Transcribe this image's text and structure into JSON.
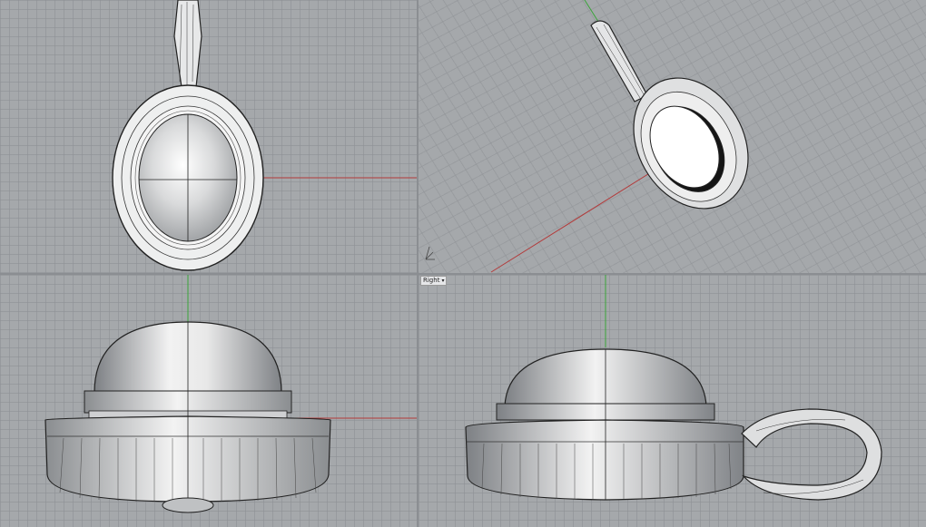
{
  "viewports": {
    "right": {
      "label": "Right"
    }
  },
  "colors": {
    "background": "#a5a8ab",
    "grid": "#8c8f93",
    "x_axis": "#b33a3a",
    "y_axis": "#3aa33a",
    "model_fill": "#d7d8da",
    "wire": "#1e1e1e"
  },
  "icons": {
    "tab_dropdown": "chevron-down-icon",
    "gumball": "axis-gizmo-icon"
  }
}
